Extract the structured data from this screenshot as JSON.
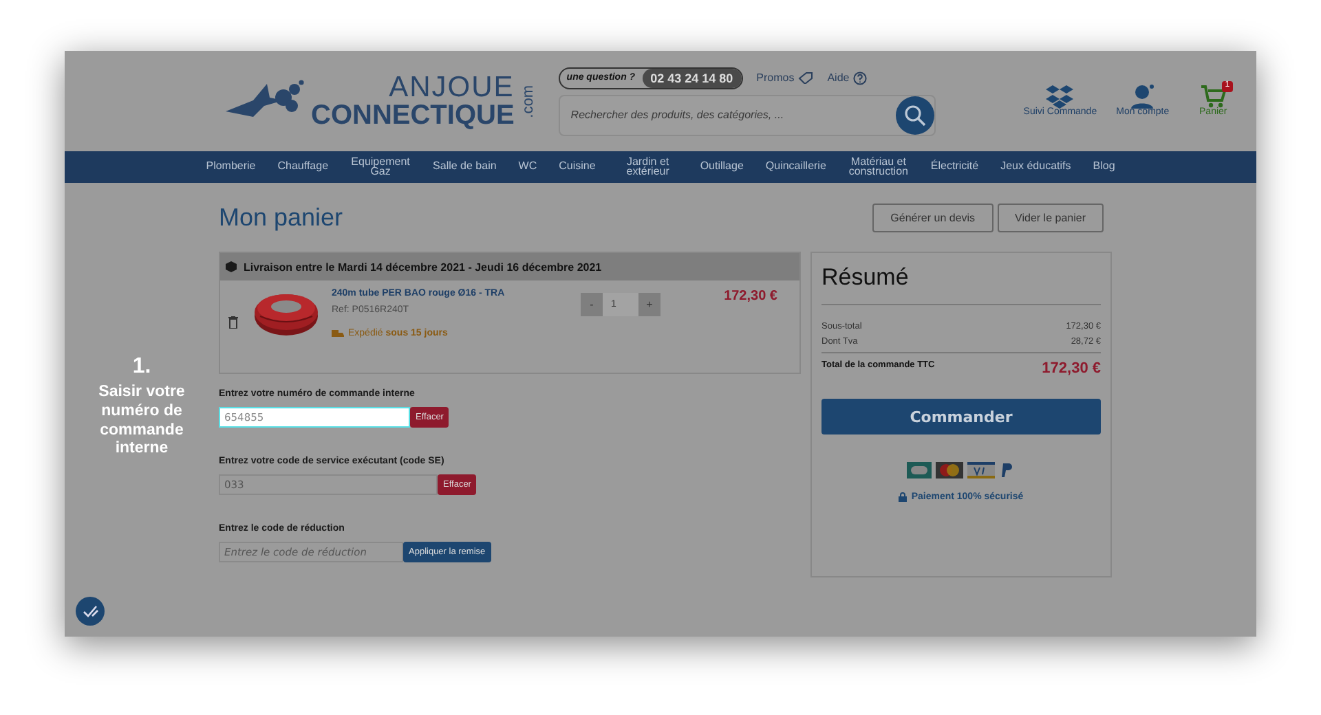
{
  "header": {
    "logo": {
      "line1": "ANJOUE",
      "line2": "CONNECTIQUE",
      "suffix": ".com"
    },
    "contact": {
      "label": "une question ?",
      "phone": "02 43 24 14 80"
    },
    "links": [
      {
        "kind": "promos",
        "label": "Promos"
      },
      {
        "kind": "help",
        "label": "Aide"
      }
    ],
    "search": {
      "placeholder": "Rechercher des produits, des catégories, ..."
    },
    "actions": [
      {
        "kind": "orders",
        "label": "Suivi Commande"
      },
      {
        "kind": "account",
        "label": "Mon compte"
      },
      {
        "kind": "cart",
        "label": "Panier",
        "badge": "1"
      }
    ]
  },
  "nav": [
    "Plomberie",
    "Chauffage",
    "Equipement Gaz",
    "Salle de bain",
    "WC",
    "Cuisine",
    "Jardin et extérieur",
    "Outillage",
    "Quincaillerie",
    "Matériau et construction",
    "Électricité",
    "Jeux éducatifs",
    "Blog"
  ],
  "tutorial": {
    "step": "1.",
    "text": "Saisir votre numéro de commande interne"
  },
  "page_title": "Mon panier",
  "page_actions": [
    "Générer un devis",
    "Vider le panier"
  ],
  "delivery": "Livraison entre le Mardi 14 décembre 2021 - Jeudi 16 décembre 2021",
  "cart_items": [
    {
      "name": "240m tube PER BAO rouge Ø16 - TRA",
      "ref": "Ref: P0516R240T",
      "shipping": "Expédié **sous 15 jours**",
      "minus": "-",
      "qty": "1",
      "plus": "+",
      "price": "172,30 €"
    }
  ],
  "forms": [
    {
      "kind": "clear",
      "label": "Entrez votre numéro de commande interne",
      "value": "654855",
      "button": "Effacer",
      "highlighted": true
    },
    {
      "kind": "clear",
      "label": "Entrez votre code de service exécutant (code SE)",
      "value": "033",
      "button": "Effacer",
      "highlighted": false
    },
    {
      "kind": "apply",
      "label": "Entrez le code de réduction",
      "placeholder": "Entrez le code de réduction",
      "button": "Appliquer la remise",
      "highlighted": false
    }
  ],
  "summary": {
    "title": "Résumé",
    "lines": [
      {
        "label": "Sous-total",
        "value": "172,30 €"
      },
      {
        "label": "Dont Tva",
        "value": "28,72 €"
      }
    ],
    "total": {
      "label": "Total de la commande TTC",
      "value": "172,30 €"
    },
    "checkout": "Commander",
    "secure": "Paiement 100% sécurisé"
  }
}
